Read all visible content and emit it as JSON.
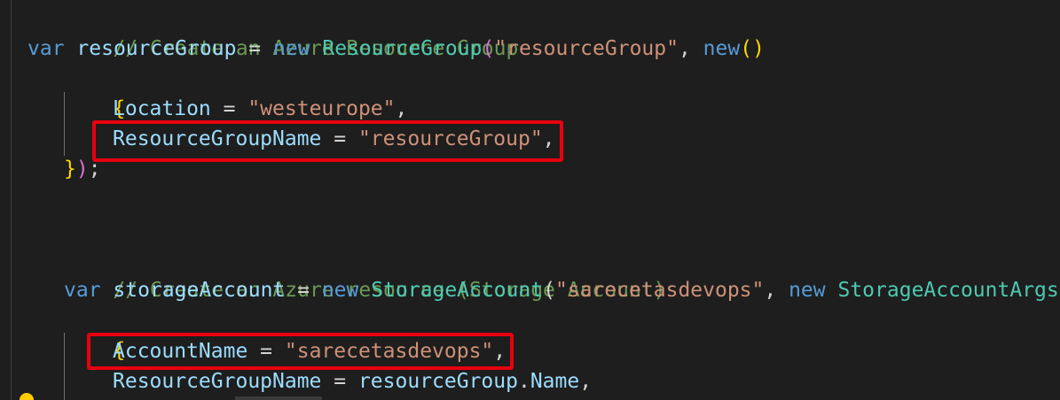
{
  "editor": {
    "lines": {
      "comment_rg": "// Create an Azure Resource Group",
      "rg_var_kw": "var",
      "rg_var_name": "resourceGroup",
      "rg_eq": " = ",
      "rg_new": "new",
      "rg_type": "ResourceGroup",
      "rg_open": "(",
      "rg_arg": "\"resourceGroup\"",
      "rg_comma": ", ",
      "rg_new2": "new",
      "rg_parens": "()",
      "rg_brace_open": "{",
      "loc_prop": "Location",
      "loc_eq": " = ",
      "loc_val": "\"westeurope\"",
      "loc_comma": ",",
      "rgn_prop": "ResourceGroupName",
      "rgn_eq": " = ",
      "rgn_val": "\"resourceGroup\"",
      "rgn_comma": ",",
      "rg_brace_close": "}",
      "rg_paren_close": ")",
      "rg_semi": ";",
      "comment_sa": "// Create an Azure resource (Storage Account)",
      "sa_var_kw": "var",
      "sa_var_name": "storageAccount",
      "sa_eq": " = ",
      "sa_new": "new",
      "sa_type": "StorageAccount",
      "sa_open": "(",
      "sa_arg": "\"sarecetasdevops\"",
      "sa_comma": ", ",
      "sa_new2": "new",
      "sa_args_type": "StorageAccountArgs",
      "sa_brace_open": "{",
      "acc_prop": "AccountName",
      "acc_eq": " = ",
      "acc_val": "\"sarecetasdevops\"",
      "acc_comma": ",",
      "sa_rgn_prop": "ResourceGroupName",
      "sa_rgn_eq": " = ",
      "sa_rgn_obj": "resourceGroup",
      "sa_rgn_dot": ".",
      "sa_rgn_member": "Name",
      "sa_rgn_comma": ","
    },
    "colors": {
      "background": "#1e1e1e",
      "keyword": "#569cd6",
      "variable": "#9cdcfe",
      "type": "#4ec9b0",
      "string": "#ce9178",
      "comment": "#6a9955",
      "bracket_gold": "#ffd700",
      "bracket_purple": "#da70d6",
      "highlight_box": "#e8000f"
    },
    "icons": [
      "lightbulb-icon"
    ]
  }
}
